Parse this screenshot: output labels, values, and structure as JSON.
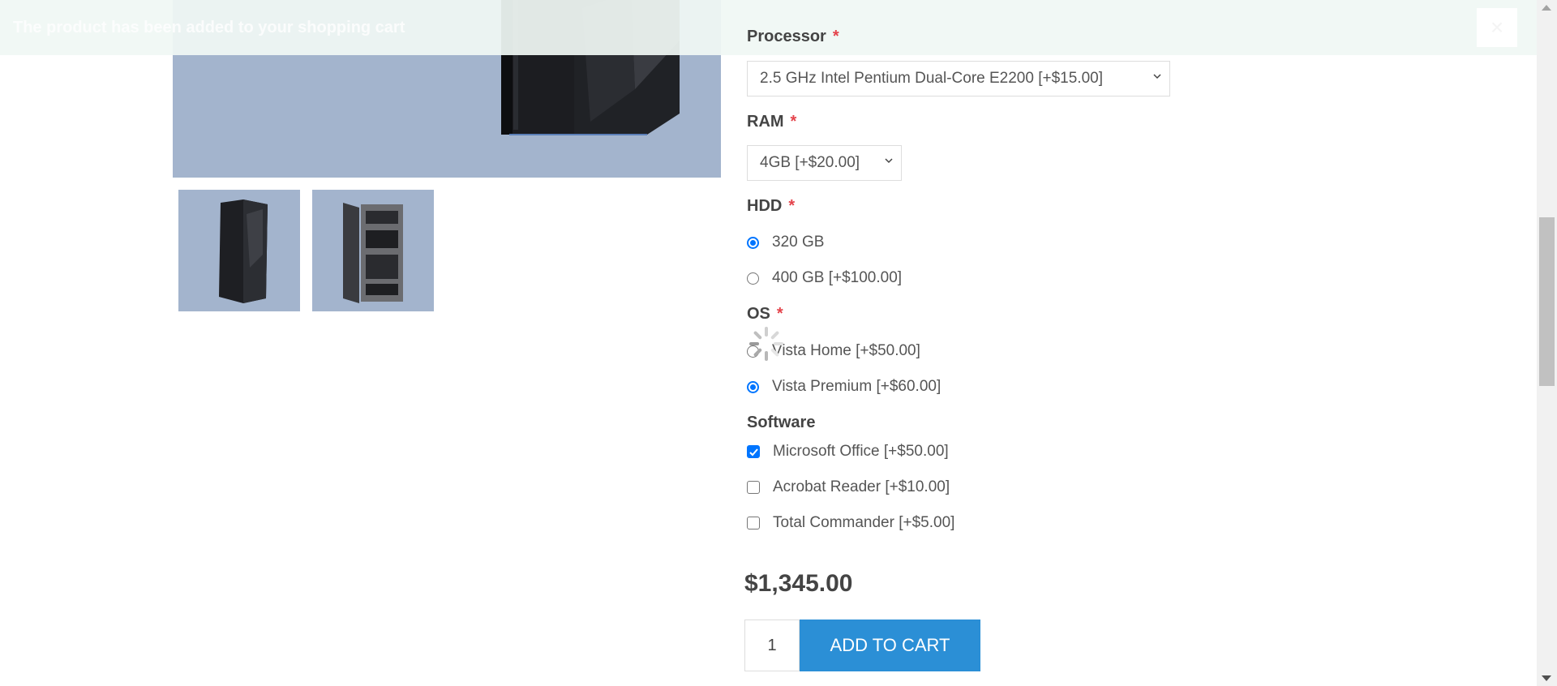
{
  "notification": {
    "text": "The product has been added to your shopping cart",
    "close_symbol": "×"
  },
  "attributes": {
    "processor": {
      "label": "Processor",
      "required_mark": "*",
      "selected": "2.5 GHz Intel Pentium Dual-Core E2200 [+$15.00]"
    },
    "ram": {
      "label": "RAM",
      "required_mark": "*",
      "selected": "4GB [+$20.00]"
    },
    "hdd": {
      "label": "HDD",
      "required_mark": "*",
      "options": [
        {
          "label": "320 GB",
          "checked": true
        },
        {
          "label": "400 GB [+$100.00]",
          "checked": false
        }
      ]
    },
    "os": {
      "label": "OS",
      "required_mark": "*",
      "options": [
        {
          "label": "Vista Home [+$50.00]",
          "checked": false
        },
        {
          "label": "Vista Premium [+$60.00]",
          "checked": true
        }
      ]
    },
    "software": {
      "label": "Software",
      "options": [
        {
          "label": "Microsoft Office [+$50.00]",
          "checked": true
        },
        {
          "label": "Acrobat Reader [+$10.00]",
          "checked": false
        },
        {
          "label": "Total Commander [+$5.00]",
          "checked": false
        }
      ]
    }
  },
  "price": "$1,345.00",
  "quantity": "1",
  "add_to_cart_label": "ADD TO CART",
  "colors": {
    "accent": "#2b8fd6",
    "required": "#e4434b",
    "image_bg": "#a3b4cd",
    "radio_checked": "#0075ff"
  }
}
